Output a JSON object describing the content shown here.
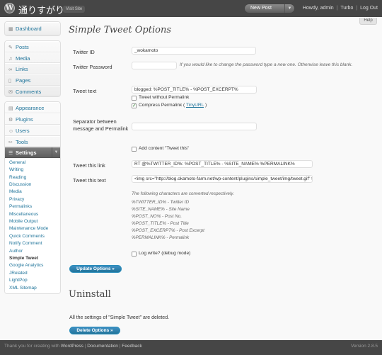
{
  "header": {
    "site_title": "通りすがり",
    "visit_site": "Visit Site",
    "new_post": "New Post",
    "howdy": "Howdy,",
    "user": "admin",
    "turbo": "Turbo",
    "logout": "Log Out"
  },
  "help": "Help",
  "sidebar": {
    "dashboard": "Dashboard",
    "posts": "Posts",
    "media": "Media",
    "links": "Links",
    "pages": "Pages",
    "comments": "Comments",
    "appearance": "Appearance",
    "plugins": "Plugins",
    "users": "Users",
    "tools": "Tools",
    "settings": "Settings",
    "settings_sub": [
      "General",
      "Writing",
      "Reading",
      "Discussion",
      "Media",
      "Privacy",
      "Permalinks",
      "Miscellaneous",
      "Mobile Output",
      "Maintenance Mode",
      "Quick Comments",
      "Notify Comment",
      "Author",
      "Simple Tweet",
      "Google Analytics",
      "JRelated",
      "LightPop",
      "XML Sitemap"
    ]
  },
  "main": {
    "title": "Simple Tweet Options",
    "twitter_id_label": "Twitter ID",
    "twitter_id_value": "_wokamoto",
    "twitter_password_label": "Twitter Password",
    "password_hint": "If you would like to change the password type a new one. Otherwise leave this blank.",
    "tweet_text_label": "Tweet text",
    "tweet_text_value": "blogged: %POST_TITLE% - %POST_EXCERPT%",
    "tweet_without_permalink": "Tweet without Permalink",
    "compress_permalink": "Compress Permalink (",
    "tinyurl": "TinyURL",
    "compress_close": ")",
    "separator_label": "Separator between message and Permalink",
    "separator_value": "",
    "add_content": "Add content \"Tweet this\"",
    "tweet_this_link_label": "Tweet this link",
    "tweet_this_link_value": "RT @%TWITTER_ID%: %POST_TITLE% - %SITE_NAME% %PERMALINK%",
    "tweet_this_text_label": "Tweet this text",
    "tweet_this_text_value": "<img src=\"http://blog.okamoto-farm.net/wp-content/plugins/simple_tweet/img/tweet.gif\" title=\"",
    "converted_intro": "The following characters are converted respectively.",
    "conversions": [
      "%TWITTER_ID% - Twitter ID",
      "%SITE_NAME% - Site Name",
      "%POST_NO% - Post No.",
      "%POST_TITLE% - Post Title",
      "%POST_EXCERPT% - Post Excerpt",
      "%PERMALINK% - Permalink"
    ],
    "log_write": "Log write? (debug mode)",
    "update_button": "Update Options »",
    "uninstall_title": "Uninstall",
    "uninstall_text": "All the settings of \"Simple Tweet\" are deleted.",
    "delete_button": "Delete Options »"
  },
  "footer": {
    "thanks": "Thank you for creating with",
    "wordpress": "WordPress",
    "documentation": "Documentation",
    "feedback": "Feedback",
    "version": "Version 2.8.5"
  }
}
